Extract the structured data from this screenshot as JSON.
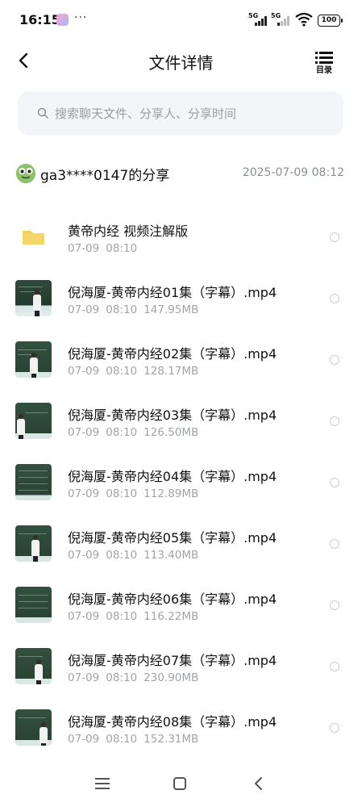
{
  "status_bar": {
    "time": "16:15",
    "more": "···",
    "signal1_label": "5G",
    "signal2_label": "5G",
    "battery": "100"
  },
  "header": {
    "title": "文件详情",
    "toc_label": "目录"
  },
  "search": {
    "placeholder": "搜索聊天文件、分享人、分享时间"
  },
  "share": {
    "sharer": "ga3****0147的分享",
    "datetime": "2025-07-09  08:12"
  },
  "files": [
    {
      "name": "黄帝内经 视频注解版",
      "date": "07-09",
      "time": "08:10",
      "size": "",
      "type": "folder-icon"
    },
    {
      "name": "倪海厦-黄帝内经01集（字幕）.mp4",
      "date": "07-09",
      "time": "08:10",
      "size": "147.95MB",
      "type": "video-thumbnail"
    },
    {
      "name": "倪海厦-黄帝内经02集（字幕）.mp4",
      "date": "07-09",
      "time": "08:10",
      "size": "128.17MB",
      "type": "video-thumbnail"
    },
    {
      "name": "倪海厦-黄帝内经03集（字幕）.mp4",
      "date": "07-09",
      "time": "08:10",
      "size": "126.50MB",
      "type": "video-thumbnail"
    },
    {
      "name": "倪海厦-黄帝内经04集（字幕）.mp4",
      "date": "07-09",
      "time": "08:10",
      "size": "112.89MB",
      "type": "video-thumbnail"
    },
    {
      "name": "倪海厦-黄帝内经05集（字幕）.mp4",
      "date": "07-09",
      "time": "08:10",
      "size": "113.40MB",
      "type": "video-thumbnail"
    },
    {
      "name": "倪海厦-黄帝内经06集（字幕）.mp4",
      "date": "07-09",
      "time": "08:10",
      "size": "116.22MB",
      "type": "video-thumbnail"
    },
    {
      "name": "倪海厦-黄帝内经07集（字幕）.mp4",
      "date": "07-09",
      "time": "08:10",
      "size": "230.90MB",
      "type": "video-thumbnail"
    },
    {
      "name": "倪海厦-黄帝内经08集（字幕）.mp4",
      "date": "07-09",
      "time": "08:10",
      "size": "152.31MB",
      "type": "video-thumbnail"
    }
  ],
  "colors": {
    "folder": "#f5cf5a",
    "search_bg": "#f3f5f8",
    "meta_text": "#a0a3a8"
  }
}
